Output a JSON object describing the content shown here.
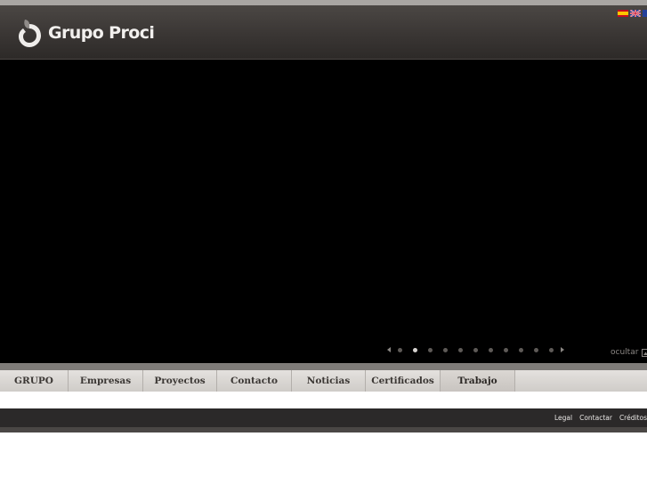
{
  "header": {
    "brand": "Grupo Proci",
    "languages": [
      "es-flag-icon",
      "uk-flag-icon",
      "third-flag-icon"
    ]
  },
  "slider": {
    "total_slides": 11,
    "active_index": 1,
    "hide_label": "ocultar"
  },
  "nav": {
    "items": [
      {
        "label": "GRUPO"
      },
      {
        "label": "Empresas"
      },
      {
        "label": "Proyectos"
      },
      {
        "label": "Contacto"
      },
      {
        "label": "Noticias"
      },
      {
        "label": "Certificados"
      },
      {
        "label": "Trabajo"
      }
    ]
  },
  "footer": {
    "links": [
      {
        "label": "Legal"
      },
      {
        "label": "Contactar"
      },
      {
        "label": "Créditos"
      }
    ]
  },
  "colors": {
    "header_bg": "#3a3634",
    "stage_bg": "#000000",
    "nav_bg": "#d8d5d1",
    "footer_bg": "#2b2929"
  }
}
